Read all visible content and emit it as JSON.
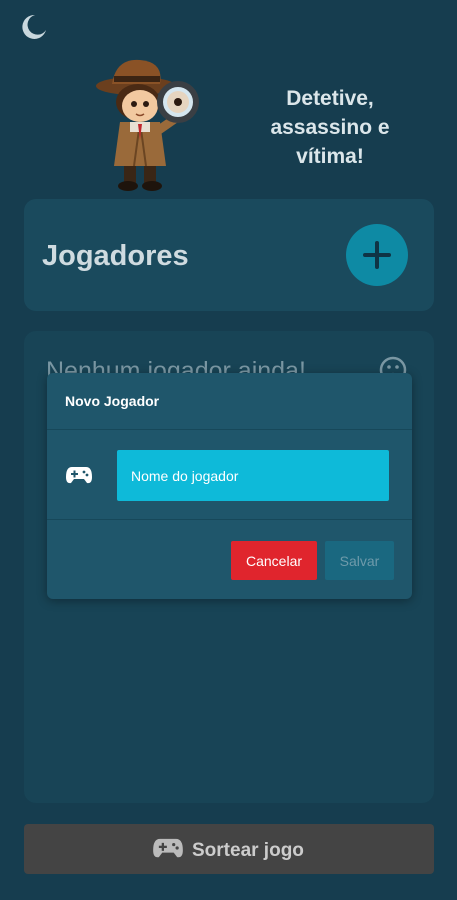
{
  "theme_toggle": {
    "icon": "moon-icon"
  },
  "header": {
    "mascot": "detective-mascot",
    "tagline": "Detetive,\nassassino e\nvítima!"
  },
  "players": {
    "title": "Jogadores",
    "add_icon": "plus-icon",
    "empty_message": "Nenhum jogador ainda!",
    "empty_icon": "sad-face-icon"
  },
  "dialog": {
    "title": "Novo Jogador",
    "input_icon": "gamepad-icon",
    "name_placeholder": "Nome do jogador",
    "name_value": "",
    "cancel_label": "Cancelar",
    "save_label": "Salvar"
  },
  "footer": {
    "draw_icon": "gamepad-icon",
    "draw_label": "Sortear jogo"
  },
  "colors": {
    "background": "#163d4f",
    "card": "#1a4a5d",
    "accent": "#0e8aa4",
    "input": "#0ebad9",
    "danger": "#e0252d",
    "disabled_button": "#444444"
  }
}
